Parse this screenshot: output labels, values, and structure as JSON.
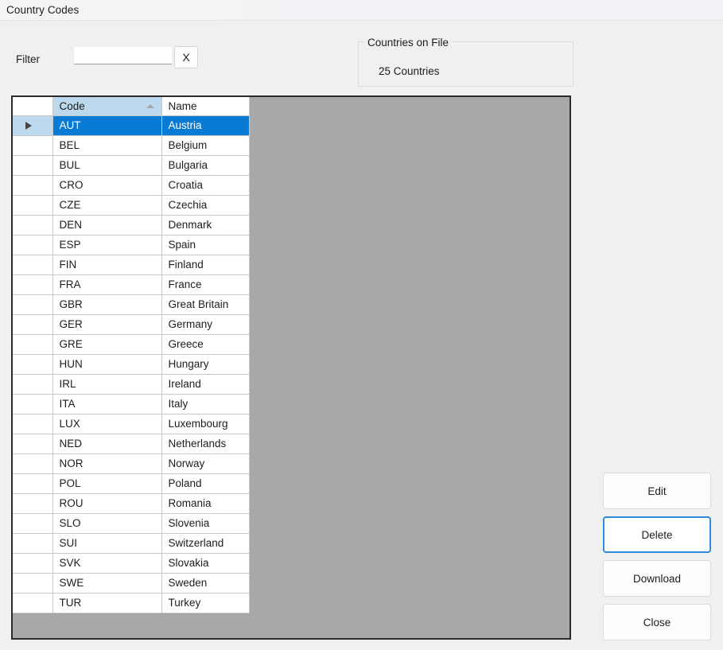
{
  "window": {
    "title": "Country Codes"
  },
  "filter": {
    "label": "Filter",
    "value": "",
    "placeholder": "",
    "clear_label": "X"
  },
  "countries_group": {
    "title": "Countries on File",
    "count_text": "25 Countries"
  },
  "grid": {
    "columns": [
      {
        "key": "rowheader",
        "label": ""
      },
      {
        "key": "code",
        "label": "Code",
        "sorted": "ascending"
      },
      {
        "key": "name",
        "label": "Name",
        "sorted": "none"
      }
    ],
    "selected_index": 0,
    "row_count": 25,
    "rows": [
      {
        "code": "AUT",
        "name": "Austria"
      },
      {
        "code": "BEL",
        "name": "Belgium"
      },
      {
        "code": "BUL",
        "name": "Bulgaria"
      },
      {
        "code": "CRO",
        "name": "Croatia"
      },
      {
        "code": "CZE",
        "name": "Czechia"
      },
      {
        "code": "DEN",
        "name": "Denmark"
      },
      {
        "code": "ESP",
        "name": "Spain"
      },
      {
        "code": "FIN",
        "name": "Finland"
      },
      {
        "code": "FRA",
        "name": "France"
      },
      {
        "code": "GBR",
        "name": "Great Britain"
      },
      {
        "code": "GER",
        "name": "Germany"
      },
      {
        "code": "GRE",
        "name": "Greece"
      },
      {
        "code": "HUN",
        "name": "Hungary"
      },
      {
        "code": "IRL",
        "name": "Ireland"
      },
      {
        "code": "ITA",
        "name": "Italy"
      },
      {
        "code": "LUX",
        "name": "Luxembourg"
      },
      {
        "code": "NED",
        "name": "Netherlands"
      },
      {
        "code": "NOR",
        "name": "Norway"
      },
      {
        "code": "POL",
        "name": "Poland"
      },
      {
        "code": "ROU",
        "name": "Romania"
      },
      {
        "code": "SLO",
        "name": "Slovenia"
      },
      {
        "code": "SUI",
        "name": "Switzerland"
      },
      {
        "code": "SVK",
        "name": "Slovakia"
      },
      {
        "code": "SWE",
        "name": "Sweden"
      },
      {
        "code": "TUR",
        "name": "Turkey"
      }
    ]
  },
  "buttons": {
    "edit": "Edit",
    "delete": "Delete",
    "download": "Download",
    "close": "Close",
    "focused": "delete"
  },
  "colors": {
    "selection_blue": "#0A7BD4",
    "sorted_header_blue": "#BDD9EE",
    "grid_background_gray": "#A8A8A8",
    "form_background": "#F0F0F0",
    "focus_border_blue": "#2E8BE0"
  }
}
